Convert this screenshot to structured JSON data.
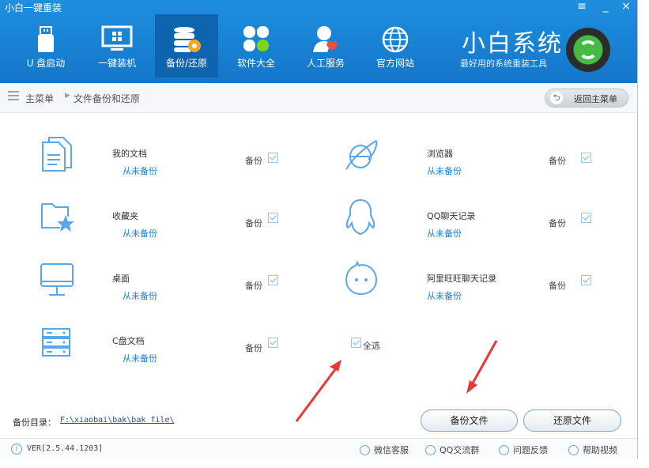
{
  "window": {
    "title": "小白一键重装",
    "controls": [
      "≡",
      "_",
      "×"
    ]
  },
  "nav": [
    {
      "label": "U 盘启动",
      "icon": "usb-drive-icon"
    },
    {
      "label": "一键装机",
      "icon": "monitor-windows-icon"
    },
    {
      "label": "备份/还原",
      "icon": "database-backup-icon",
      "active": true
    },
    {
      "label": "软件大全",
      "icon": "apps-grid-icon"
    },
    {
      "label": "人工服务",
      "icon": "person-heart-icon"
    },
    {
      "label": "官方网站",
      "icon": "globe-icon"
    }
  ],
  "brand": {
    "name": "小白系统",
    "tagline": "最好用的系统重装工具"
  },
  "breadcrumb": {
    "home": "主菜单",
    "separator": "▶",
    "current": "文件备份和还原",
    "back_label": "返回主菜单"
  },
  "items": [
    {
      "name": "我的文档",
      "status": "从未备份",
      "backup_label": "备份",
      "checked": true,
      "icon": "documents-icon"
    },
    {
      "name": "浏览器",
      "status": "从未备份",
      "backup_label": "备份",
      "checked": true,
      "icon": "browser-icon"
    },
    {
      "name": "收藏夹",
      "status": "从未备份",
      "backup_label": "备份",
      "checked": true,
      "icon": "favorites-folder-icon"
    },
    {
      "name": "QQ聊天记录",
      "status": "从未备份",
      "backup_label": "备份",
      "checked": true,
      "icon": "qq-icon"
    },
    {
      "name": "桌面",
      "status": "从未备份",
      "backup_label": "备份",
      "checked": true,
      "icon": "desktop-monitor-icon"
    },
    {
      "name": "阿里旺旺聊天记录",
      "status": "从未备份",
      "backup_label": "备份",
      "checked": true,
      "icon": "wangwang-icon"
    },
    {
      "name": "C盘文档",
      "status": "从未备份",
      "backup_label": "备份",
      "checked": true,
      "icon": "server-drive-icon"
    }
  ],
  "select_all": {
    "label": "全选",
    "checked": true
  },
  "backup_dir": {
    "label": "备份目录：",
    "path": "F:\\xiaobai\\bak\\bak file\\"
  },
  "buttons": {
    "backup": "备份文件",
    "restore": "还原文件"
  },
  "footer": {
    "version": "VER[2.5.44.1203]",
    "links": [
      {
        "label": "微信客服",
        "icon": "wechat-icon"
      },
      {
        "label": "QQ交流群",
        "icon": "qq-group-icon"
      },
      {
        "label": "问题反馈",
        "icon": "feedback-icon"
      },
      {
        "label": "帮助视频",
        "icon": "help-icon"
      }
    ]
  },
  "colors": {
    "header": "#1a84d6",
    "active_nav": "#0f64b0",
    "accent": "#1a7fd8",
    "annotation_arrow": "#e53935"
  }
}
